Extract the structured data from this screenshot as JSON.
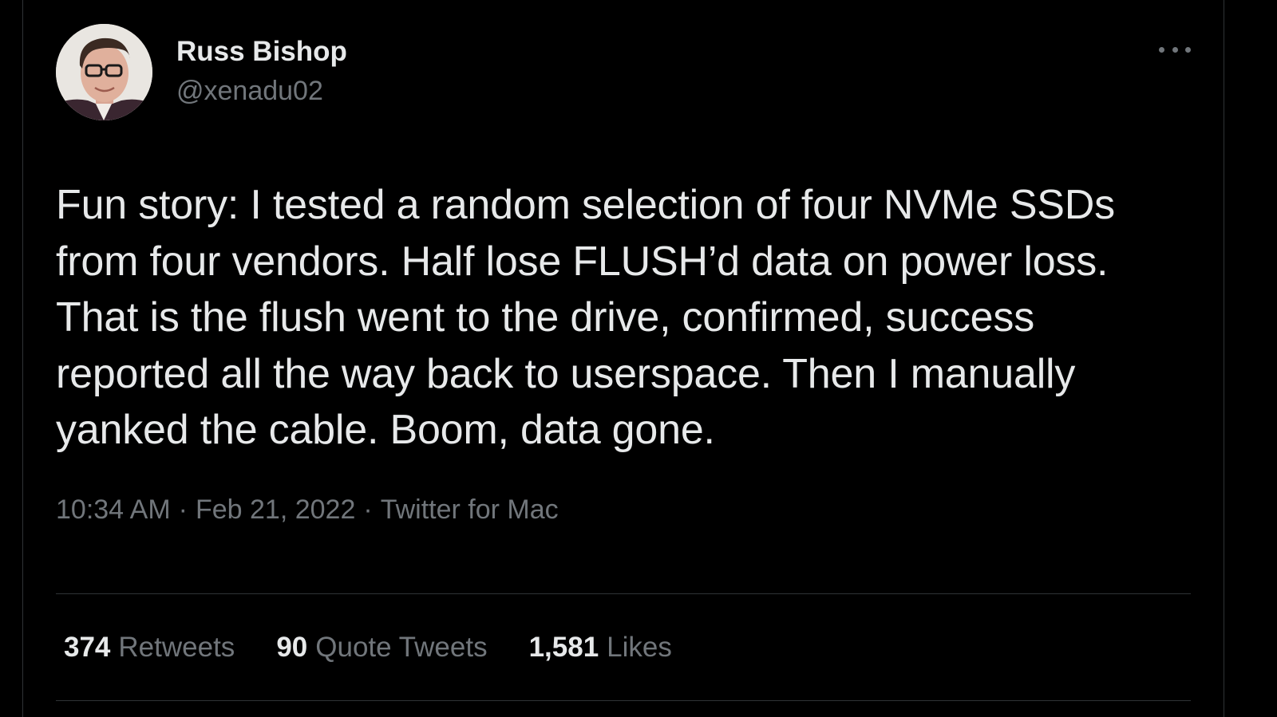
{
  "user": {
    "display_name": "Russ Bishop",
    "handle": "@xenadu02"
  },
  "tweet": {
    "text": "Fun story: I tested a random selection of four NVMe SSDs from four vendors. Half lose FLUSH’d data on power loss. That is the flush went to the drive, confirmed, success reported all the way back to userspace. Then I manually yanked the cable. Boom, data gone.",
    "time": "10:34 AM",
    "date": "Feb 21, 2022",
    "separator": "·",
    "source": "Twitter for Mac"
  },
  "stats": {
    "retweets_count": "374",
    "retweets_label": "Retweets",
    "quotes_count": "90",
    "quotes_label": "Quote Tweets",
    "likes_count": "1,581",
    "likes_label": "Likes"
  },
  "icons": {
    "more": "more-horizontal-icon"
  },
  "colors": {
    "background": "#000000",
    "primary_text": "#e7e9ea",
    "secondary_text": "#71767b",
    "border": "#2f3336"
  }
}
